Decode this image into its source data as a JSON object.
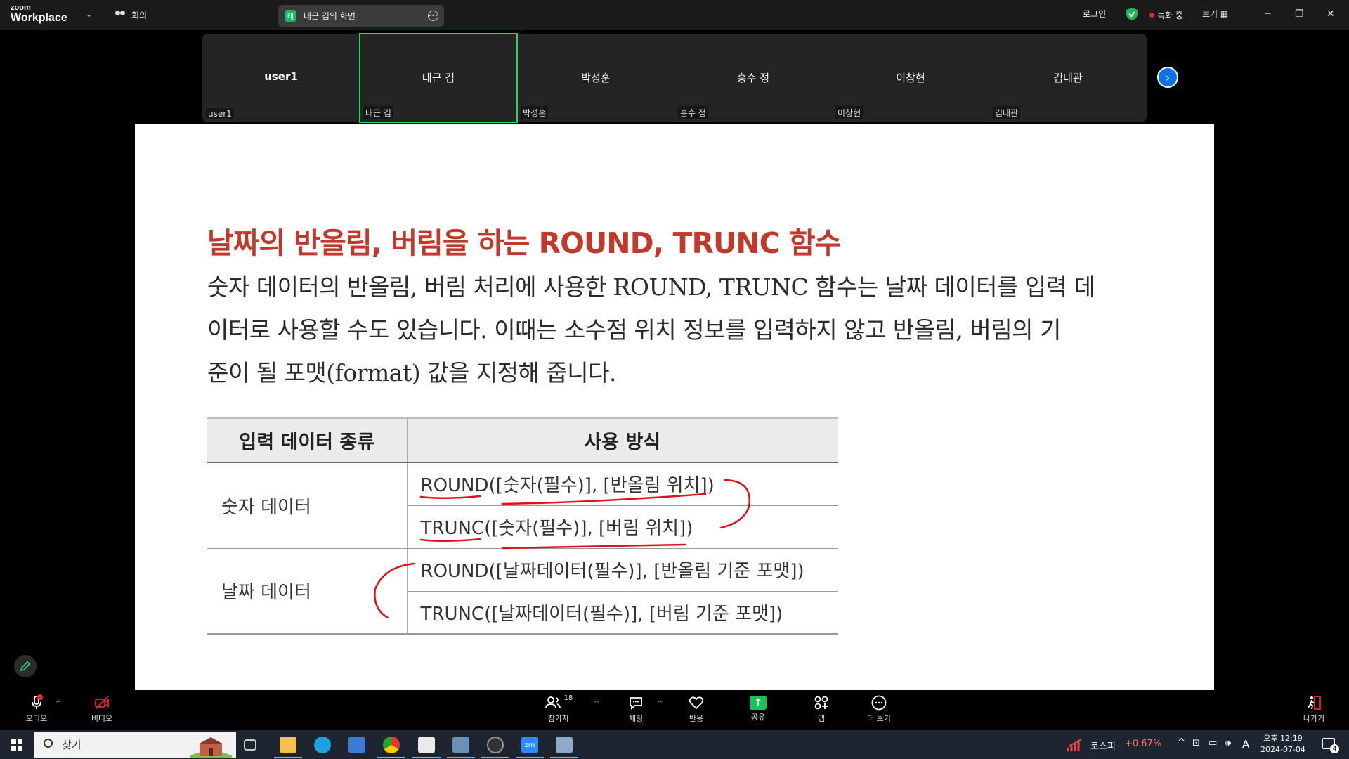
{
  "app": {
    "brand_top": "zoom",
    "brand_bottom": "Workplace",
    "meeting_label": "회의",
    "share_badge": "태",
    "share_title": "태근 김의 화면",
    "login": "로그인",
    "recording": "녹화 중",
    "view": "보기"
  },
  "participants": [
    {
      "name": "user1",
      "tag": "user1"
    },
    {
      "name": "태근 김",
      "tag": "태근 김"
    },
    {
      "name": "박성훈",
      "tag": "박성훈"
    },
    {
      "name": "흥수 정",
      "tag": "흥수 정"
    },
    {
      "name": "이창현",
      "tag": "이창현"
    },
    {
      "name": "김태관",
      "tag": "김태관"
    }
  ],
  "slide": {
    "title": "날짜의 반올림, 버림을 하는 ROUND, TRUNC 함수",
    "body_line1": "숫자 데이터의 반올림, 버림 처리에 사용한 ROUND, TRUNC 함수는 날짜 데이터를 입력 데",
    "body_line2": "이터로 사용할 수도 있습니다. 이때는 소수점 위치 정보를 입력하지 않고 반올림, 버림의 기",
    "body_line3": "준이 될 포맷(format) 값을 지정해 줍니다.",
    "table": {
      "headers": [
        "입력 데이터 종류",
        "사용 방식"
      ],
      "rows": [
        {
          "kind": "숫자 데이터",
          "usages": [
            "ROUND([숫자(필수)], [반올림 위치])",
            "TRUNC([숫자(필수)], [버림 위치])"
          ]
        },
        {
          "kind": "날짜 데이터",
          "usages": [
            "ROUND([날짜데이터(필수)], [반올림 기준 포맷])",
            "TRUNC([날짜데이터(필수)], [버림 기준 포맷])"
          ]
        }
      ]
    },
    "ink_color": "#e0101a"
  },
  "toolbar": {
    "audio": "오디오",
    "video": "비디오",
    "participants": "참가자",
    "participants_count": "18",
    "chat": "채팅",
    "reactions": "반응",
    "share": "공유",
    "apps": "앱",
    "more": "더 보기",
    "leave": "나가기"
  },
  "taskbar": {
    "search_placeholder": "찾기",
    "stock_name": "코스피",
    "stock_change": "+0.67%",
    "ime": "A",
    "time": "오후 12:19",
    "date": "2024-07-04",
    "notifications": "4"
  },
  "colors": {
    "accent_green": "#2bd46b",
    "zoom_blue": "#0e71eb",
    "title_red": "#c0392b"
  }
}
